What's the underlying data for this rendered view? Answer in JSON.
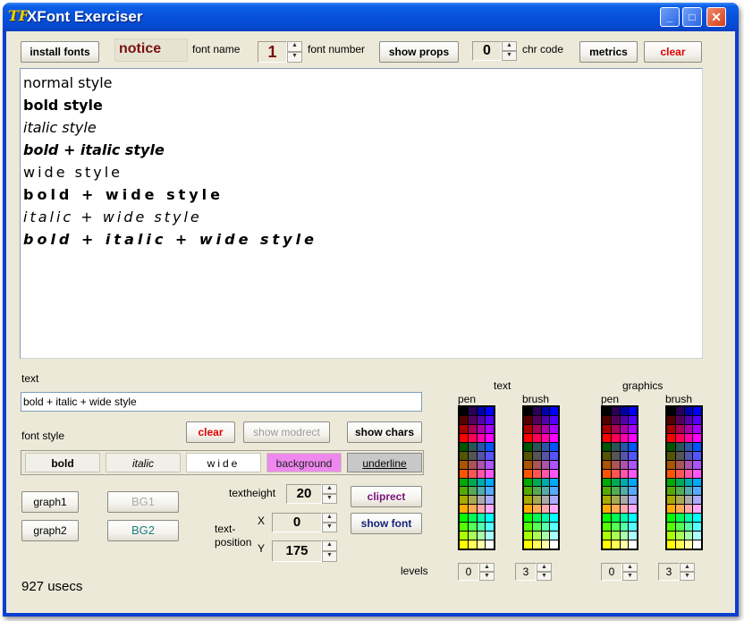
{
  "window": {
    "title": "XFont Exerciser",
    "app_icon": "TF",
    "min_glyph": "_",
    "max_glyph": "□",
    "close_glyph": "✕"
  },
  "toolbar": {
    "install_fonts": "install fonts",
    "notice": "notice",
    "font_name_label": "font name",
    "font_number_value": "1",
    "font_number_label": "font number",
    "show_props": "show props",
    "chr_code_value": "0",
    "chr_code_label": "chr code",
    "metrics": "metrics",
    "clear": "clear"
  },
  "samples": [
    "normal style",
    "bold style",
    "italic style",
    "bold + italic style",
    "wide style",
    "bold + wide style",
    "italic + wide style",
    "bold + italic + wide style"
  ],
  "text_section": {
    "label": "text",
    "value": "bold + italic + wide style"
  },
  "font_style": {
    "label": "font style",
    "clear": "clear",
    "show_modrect": "show modrect",
    "show_chars": "show chars",
    "bold": "bold",
    "italic": "italic",
    "wide": "wide",
    "background": "background",
    "underline": "underline"
  },
  "lower": {
    "graph1": "graph1",
    "graph2": "graph2",
    "bg1": "BG1",
    "bg2": "BG2",
    "textheight_label": "textheight",
    "textheight_value": "20",
    "textposition_label": "text-\nposition",
    "x_label": "X",
    "x_value": "0",
    "y_label": "Y",
    "y_value": "175",
    "cliprect": "cliprect",
    "show_font": "show font",
    "usecs": "927 usecs"
  },
  "colors": {
    "text_header": "text",
    "graphics_header": "graphics",
    "pen": "pen",
    "brush": "brush",
    "levels_label": "levels",
    "text_pen_level": "0",
    "text_brush_level": "3",
    "graphics_pen_level": "0",
    "graphics_brush_level": "3",
    "palette": [
      "#000000",
      "#2a0055",
      "#0000aa",
      "#0000ff",
      "#550000",
      "#55005a",
      "#5500aa",
      "#5500ff",
      "#aa0000",
      "#aa0055",
      "#aa00aa",
      "#aa00ff",
      "#ff0000",
      "#ff0055",
      "#ff00aa",
      "#ff00ff",
      "#005500",
      "#2a5555",
      "#2a55aa",
      "#0055ff",
      "#555500",
      "#555555",
      "#5555aa",
      "#5555ff",
      "#aa5500",
      "#aa5555",
      "#aa55aa",
      "#aa55ff",
      "#ff5500",
      "#ff5555",
      "#ff55aa",
      "#ff55ff",
      "#00aa00",
      "#00aa55",
      "#00aaaa",
      "#00aaff",
      "#55aa00",
      "#55aa55",
      "#55aaaa",
      "#55aaff",
      "#aaaa00",
      "#aaaa55",
      "#aaaaaa",
      "#aaaaff",
      "#ffaa00",
      "#ffaa55",
      "#ffaaaa",
      "#ffaaff",
      "#00ff00",
      "#00ff55",
      "#00ffaa",
      "#00ffff",
      "#55ff00",
      "#55ff55",
      "#55ffaa",
      "#55ffff",
      "#aaff00",
      "#aaff55",
      "#aaffaa",
      "#aaffff",
      "#ffff00",
      "#ffff55",
      "#ffffaa",
      "#ffffff"
    ]
  }
}
